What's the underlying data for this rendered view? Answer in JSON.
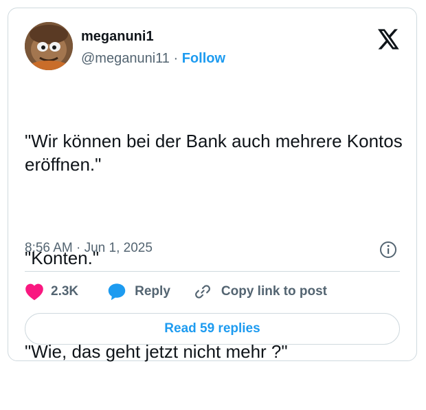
{
  "author": {
    "name": "meganuni1",
    "handle": "@meganuni11",
    "separator": "·",
    "follow_label": "Follow"
  },
  "tweet": {
    "lines": [
      "\"Wir können bei der Bank auch mehrere Kontos eröffnen.\"",
      "\"Konten.\"",
      "\"Wie, das geht jetzt nicht mehr ?\""
    ],
    "timestamp": "8:56 AM · Jun 1, 2025"
  },
  "actions": {
    "like_count": "2.3K",
    "reply_label": "Reply",
    "copy_link_label": "Copy link to post"
  },
  "read_replies_label": "Read 59 replies",
  "colors": {
    "accent": "#1d9bf0",
    "like": "#f91880",
    "muted": "#536471",
    "border": "#cfd9de"
  },
  "icons": [
    "x-logo-icon",
    "info-icon",
    "heart-icon",
    "reply-bubble-icon",
    "link-icon"
  ]
}
